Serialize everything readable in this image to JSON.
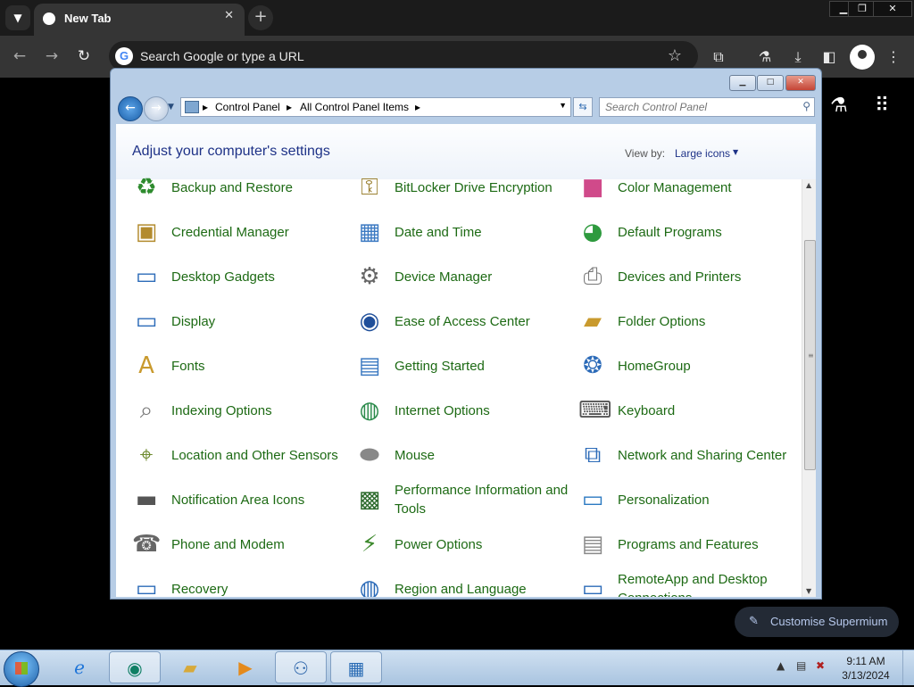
{
  "browser": {
    "tab_title": "New Tab",
    "tab_close": "✕",
    "new_tab": "+",
    "address_placeholder": "Search Google or type a URL",
    "google_letter": "G",
    "window_buttons": [
      "▁",
      "❐",
      "✕"
    ]
  },
  "control_panel": {
    "breadcrumbs": [
      "Control Panel",
      "All Control Panel Items"
    ],
    "search_placeholder": "Search Control Panel",
    "heading": "Adjust your computer's settings",
    "view_by_label": "View by:",
    "view_by_value": "Large icons",
    "columns": [
      [
        {
          "label": "Backup and Restore",
          "icon": "backup-icon"
        },
        {
          "label": "Credential Manager",
          "icon": "vault-icon"
        },
        {
          "label": "Desktop Gadgets",
          "icon": "gadgets-icon"
        },
        {
          "label": "Display",
          "icon": "display-icon"
        },
        {
          "label": "Fonts",
          "icon": "fonts-folder-icon"
        },
        {
          "label": "Indexing Options",
          "icon": "indexing-icon"
        },
        {
          "label": "Location and Other Sensors",
          "icon": "sensors-icon"
        },
        {
          "label": "Notification Area Icons",
          "icon": "notification-icon"
        },
        {
          "label": "Phone and Modem",
          "icon": "phone-icon"
        },
        {
          "label": "Recovery",
          "icon": "recovery-icon"
        }
      ],
      [
        {
          "label": "BitLocker Drive Encryption",
          "icon": "bitlocker-key-icon"
        },
        {
          "label": "Date and Time",
          "icon": "calendar-clock-icon"
        },
        {
          "label": "Device Manager",
          "icon": "device-manager-icon"
        },
        {
          "label": "Ease of Access Center",
          "icon": "ease-of-access-icon"
        },
        {
          "label": "Getting Started",
          "icon": "getting-started-icon"
        },
        {
          "label": "Internet Options",
          "icon": "globe-checklist-icon"
        },
        {
          "label": "Mouse",
          "icon": "mouse-icon"
        },
        {
          "label": "Performance Information and Tools",
          "icon": "performance-icon"
        },
        {
          "label": "Power Options",
          "icon": "power-icon"
        },
        {
          "label": "Region and Language",
          "icon": "region-globe-icon"
        }
      ],
      [
        {
          "label": "Color Management",
          "icon": "color-icon"
        },
        {
          "label": "Default Programs",
          "icon": "default-programs-icon"
        },
        {
          "label": "Devices and Printers",
          "icon": "printer-icon"
        },
        {
          "label": "Folder Options",
          "icon": "folder-options-icon"
        },
        {
          "label": "HomeGroup",
          "icon": "homegroup-icon"
        },
        {
          "label": "Keyboard",
          "icon": "keyboard-icon"
        },
        {
          "label": "Network and Sharing Center",
          "icon": "network-icon"
        },
        {
          "label": "Personalization",
          "icon": "personalization-icon"
        },
        {
          "label": "Programs and Features",
          "icon": "programs-icon"
        },
        {
          "label": "RemoteApp and Desktop Connections",
          "icon": "remoteapp-icon"
        }
      ]
    ]
  },
  "customise": {
    "label": "Customise Supermium"
  },
  "taskbar": {
    "time": "9:11 AM",
    "date": "3/13/2024"
  }
}
